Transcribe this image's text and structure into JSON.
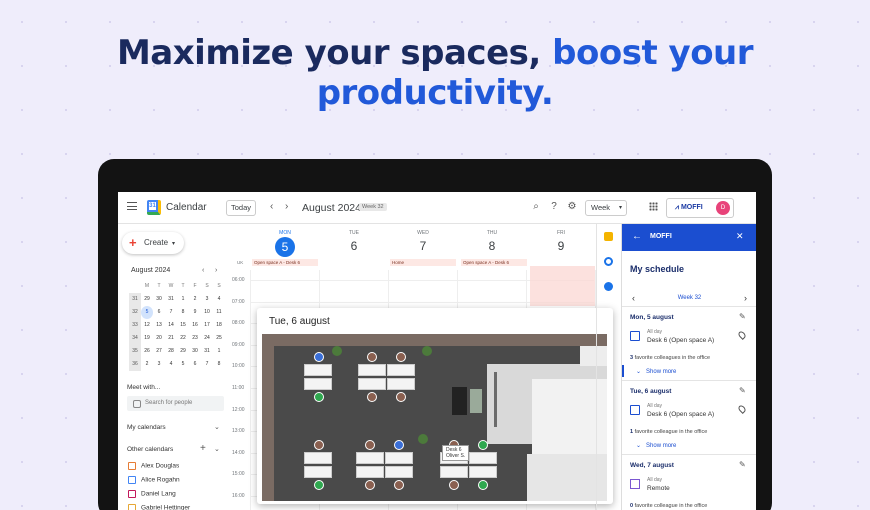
{
  "headline": {
    "part1": "Maximize your spaces,",
    "part2": "boost your productivity."
  },
  "topbar": {
    "app_title": "Calendar",
    "logo_day": "31",
    "today_label": "Today",
    "prev": "‹",
    "next": "›",
    "month_title": "August 2024",
    "week_badge": "Week 32",
    "view_select": "Week",
    "moffi_button": "MOFFI",
    "avatar_initial": "D"
  },
  "sidebar": {
    "create_label": "Create",
    "mini_month": "August 2024",
    "weekday_headers": [
      "",
      "M",
      "T",
      "W",
      "T",
      "F",
      "S",
      "S"
    ],
    "weeks": [
      [
        "31",
        "29",
        "30",
        "31",
        "1",
        "2",
        "3",
        "4"
      ],
      [
        "32",
        "5",
        "6",
        "7",
        "8",
        "9",
        "10",
        "11"
      ],
      [
        "33",
        "12",
        "13",
        "14",
        "15",
        "16",
        "17",
        "18"
      ],
      [
        "34",
        "19",
        "20",
        "21",
        "22",
        "23",
        "24",
        "25"
      ],
      [
        "35",
        "26",
        "27",
        "28",
        "29",
        "30",
        "31",
        "1"
      ],
      [
        "36",
        "2",
        "3",
        "4",
        "5",
        "6",
        "7",
        "8"
      ]
    ],
    "meet_with": "Meet with...",
    "search_people": "Search for people",
    "my_calendars": "My calendars",
    "other_calendars": "Other calendars",
    "calendars": [
      {
        "name": "Alex Douglas",
        "color": "#e67c35"
      },
      {
        "name": "Alice Rogahn",
        "color": "#4285f4"
      },
      {
        "name": "Daniel Lang",
        "color": "#c2185b"
      },
      {
        "name": "Gabriel Hettinger",
        "color": "#e6a735"
      }
    ]
  },
  "days": [
    {
      "name": "MON",
      "num": "5",
      "today": true
    },
    {
      "name": "TUE",
      "num": "6"
    },
    {
      "name": "WED",
      "num": "7"
    },
    {
      "name": "THU",
      "num": "8"
    },
    {
      "name": "FRI",
      "num": "9"
    }
  ],
  "timezone": "UK",
  "allday_events": [
    "Open space A - Desk 6",
    "Home",
    "Open space A - Desk 6"
  ],
  "times": [
    "06:00",
    "07:00",
    "08:00",
    "09:00",
    "10:00",
    "11:00",
    "12:00",
    "13:00",
    "14:00",
    "15:00",
    "16:00"
  ],
  "popup": {
    "title": "Tue, 6 august",
    "desk_tag_line1": "Desk 6",
    "desk_tag_line2": "Oliver S."
  },
  "moffi_panel": {
    "header": "MOFFI",
    "title": "My schedule",
    "week_label": "Week 32",
    "entries": [
      {
        "date": "Mon, 5 august",
        "allday": "All day",
        "location": "Desk 6 (Open space A)",
        "fav_count": "3",
        "fav_text": "favorite colleagues in the office",
        "more": "Show more",
        "type": "desk"
      },
      {
        "date": "Tue, 6 august",
        "allday": "All day",
        "location": "Desk 6 (Open space A)",
        "fav_count": "1",
        "fav_text": "favorite colleague in the office",
        "more": "Show more",
        "type": "desk"
      },
      {
        "date": "Wed, 7 august",
        "allday": "All day",
        "location": "Remote",
        "fav_count": "0",
        "fav_text": "favorite colleague in the office",
        "more": "",
        "type": "home"
      }
    ]
  }
}
